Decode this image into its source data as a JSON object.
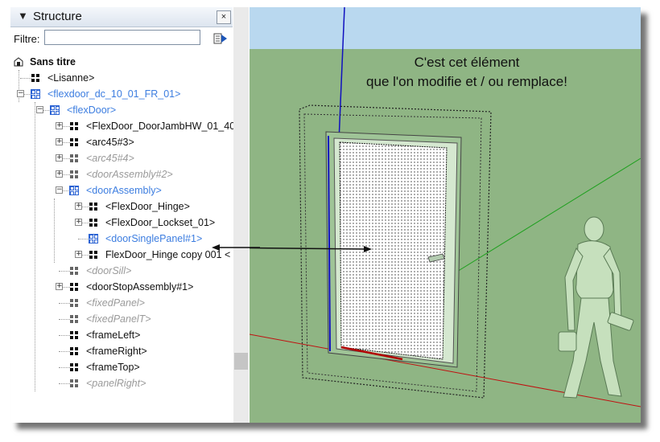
{
  "panel": {
    "title": "Structure",
    "collapse_glyph": "▼",
    "close_glyph": "×",
    "filter_label": "Filtre:",
    "filter_value": "",
    "filter_button_icon": "details-arrow-icon"
  },
  "tree": [
    {
      "label": "Sans titre",
      "style": "bold",
      "icon": "model-root-icon"
    },
    {
      "label": "<Lisanne>",
      "style": "normal",
      "icon": "component-icon"
    },
    {
      "label": "<flexdoor_dc_10_01_FR_01>",
      "style": "blue",
      "icon": "component-icon",
      "expander": "−"
    },
    {
      "label": "<flexDoor>",
      "style": "blue",
      "icon": "component-icon",
      "expander": "−"
    },
    {
      "label": "<FlexDoor_DoorJambHW_01_40",
      "style": "normal",
      "icon": "component-icon",
      "expander": "+"
    },
    {
      "label": "<arc45#3>",
      "style": "normal",
      "icon": "component-icon",
      "expander": "+"
    },
    {
      "label": "<arc45#4>",
      "style": "hidden",
      "icon": "component-icon",
      "expander": "+"
    },
    {
      "label": "<doorAssembly#2>",
      "style": "hidden",
      "icon": "component-icon",
      "expander": "+"
    },
    {
      "label": "<doorAssembly>",
      "style": "blue",
      "icon": "component-icon",
      "expander": "−"
    },
    {
      "label": "<FlexDoor_Hinge>",
      "style": "normal",
      "icon": "component-icon",
      "expander": "+"
    },
    {
      "label": "<FlexDoor_Lockset_01>",
      "style": "normal",
      "icon": "component-icon",
      "expander": "+"
    },
    {
      "label": "<doorSinglePanel#1>",
      "style": "blue",
      "icon": "component-icon"
    },
    {
      "label": "FlexDoor_Hinge copy 001 <",
      "style": "normal",
      "icon": "component-icon",
      "expander": "+"
    },
    {
      "label": "<doorSill>",
      "style": "hidden",
      "icon": "component-icon"
    },
    {
      "label": "<doorStopAssembly#1>",
      "style": "normal",
      "icon": "component-icon",
      "expander": "+"
    },
    {
      "label": "<fixedPanel>",
      "style": "hidden",
      "icon": "component-icon"
    },
    {
      "label": "<fixedPanelT>",
      "style": "hidden",
      "icon": "component-icon"
    },
    {
      "label": "<frameLeft>",
      "style": "normal",
      "icon": "component-icon"
    },
    {
      "label": "<frameRight>",
      "style": "normal",
      "icon": "component-icon"
    },
    {
      "label": "<frameTop>",
      "style": "normal",
      "icon": "component-icon"
    },
    {
      "label": "<panelRight>",
      "style": "hidden",
      "icon": "component-icon"
    }
  ],
  "annotation": {
    "line1": "C'est cet élément",
    "line2": "que l'on modifie et / ou remplace!"
  },
  "colors": {
    "ground": "#8fb584",
    "sky": "#b9d8ef",
    "selected_blue": "#3c7de0",
    "hidden_gray": "#9a9a9a",
    "axis_red": "#c01010",
    "axis_green": "#1fa01f",
    "axis_blue": "#1010c0"
  }
}
